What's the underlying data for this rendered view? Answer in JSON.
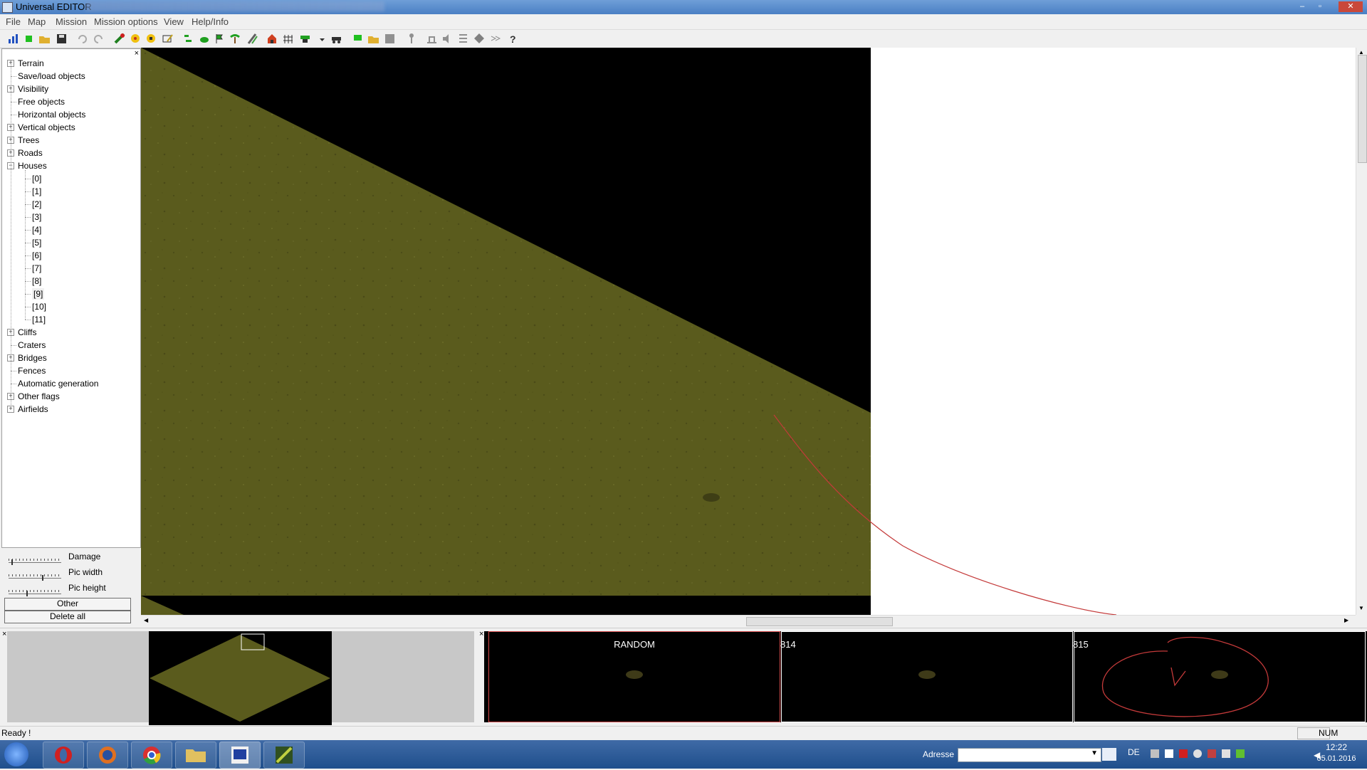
{
  "window": {
    "title": "Universal EDITOR",
    "minimize": "–",
    "maximize": "▫",
    "close": "✕"
  },
  "menu": [
    "File",
    "Map",
    "Mission",
    "Mission options",
    "View",
    "Help/Info"
  ],
  "tree": {
    "close": "×",
    "items": [
      {
        "label": "Terrain",
        "expander": "+"
      },
      {
        "label": "Save/load objects",
        "expander": ""
      },
      {
        "label": "Visibility",
        "expander": "+"
      },
      {
        "label": "Free objects",
        "expander": ""
      },
      {
        "label": "Horizontal objects",
        "expander": ""
      },
      {
        "label": "Vertical objects",
        "expander": "+"
      },
      {
        "label": "Trees",
        "expander": "+"
      },
      {
        "label": "Roads",
        "expander": "+"
      },
      {
        "label": "Houses",
        "expander": "−"
      },
      {
        "label": "[0]",
        "child": true
      },
      {
        "label": "[1]",
        "child": true
      },
      {
        "label": "[2]",
        "child": true
      },
      {
        "label": "[3]",
        "child": true
      },
      {
        "label": "[4]",
        "child": true
      },
      {
        "label": "[5]",
        "child": true
      },
      {
        "label": "[6]",
        "child": true
      },
      {
        "label": "[7]",
        "child": true
      },
      {
        "label": "[8]",
        "child": true
      },
      {
        "label": "[9]",
        "child": true,
        "selected": true
      },
      {
        "label": "[10]",
        "child": true
      },
      {
        "label": "[11]",
        "child": true
      },
      {
        "label": "Cliffs",
        "expander": "+"
      },
      {
        "label": "Craters",
        "expander": ""
      },
      {
        "label": "Bridges",
        "expander": "+"
      },
      {
        "label": "Fences",
        "expander": ""
      },
      {
        "label": "Automatic generation",
        "expander": ""
      },
      {
        "label": "Other flags",
        "expander": "+"
      },
      {
        "label": "Airfields",
        "expander": "+"
      }
    ]
  },
  "sliders": {
    "damage": {
      "label": "Damage",
      "level": 0.05
    },
    "pic_width": {
      "label": "Pic width",
      "level": 0.65
    },
    "pic_height": {
      "label": "Pic height",
      "level": 0.35
    }
  },
  "buttons": {
    "other": "Other",
    "delete_all": "Delete all"
  },
  "thumbnails": [
    {
      "label": "RANDOM"
    },
    {
      "label": "814"
    },
    {
      "label": "815"
    }
  ],
  "bottom_close_left": "×",
  "bottom_close_right": "×",
  "status": {
    "ready": "Ready !",
    "num": "NUM"
  },
  "taskbar": {
    "address_label": "Adresse",
    "language": "DE",
    "time": "12:22",
    "date": "05.01.2016"
  },
  "colors": {
    "grass": "#5b5c1e",
    "accent_red": "#d44a4a",
    "titlebar": "#5a8cd0"
  }
}
